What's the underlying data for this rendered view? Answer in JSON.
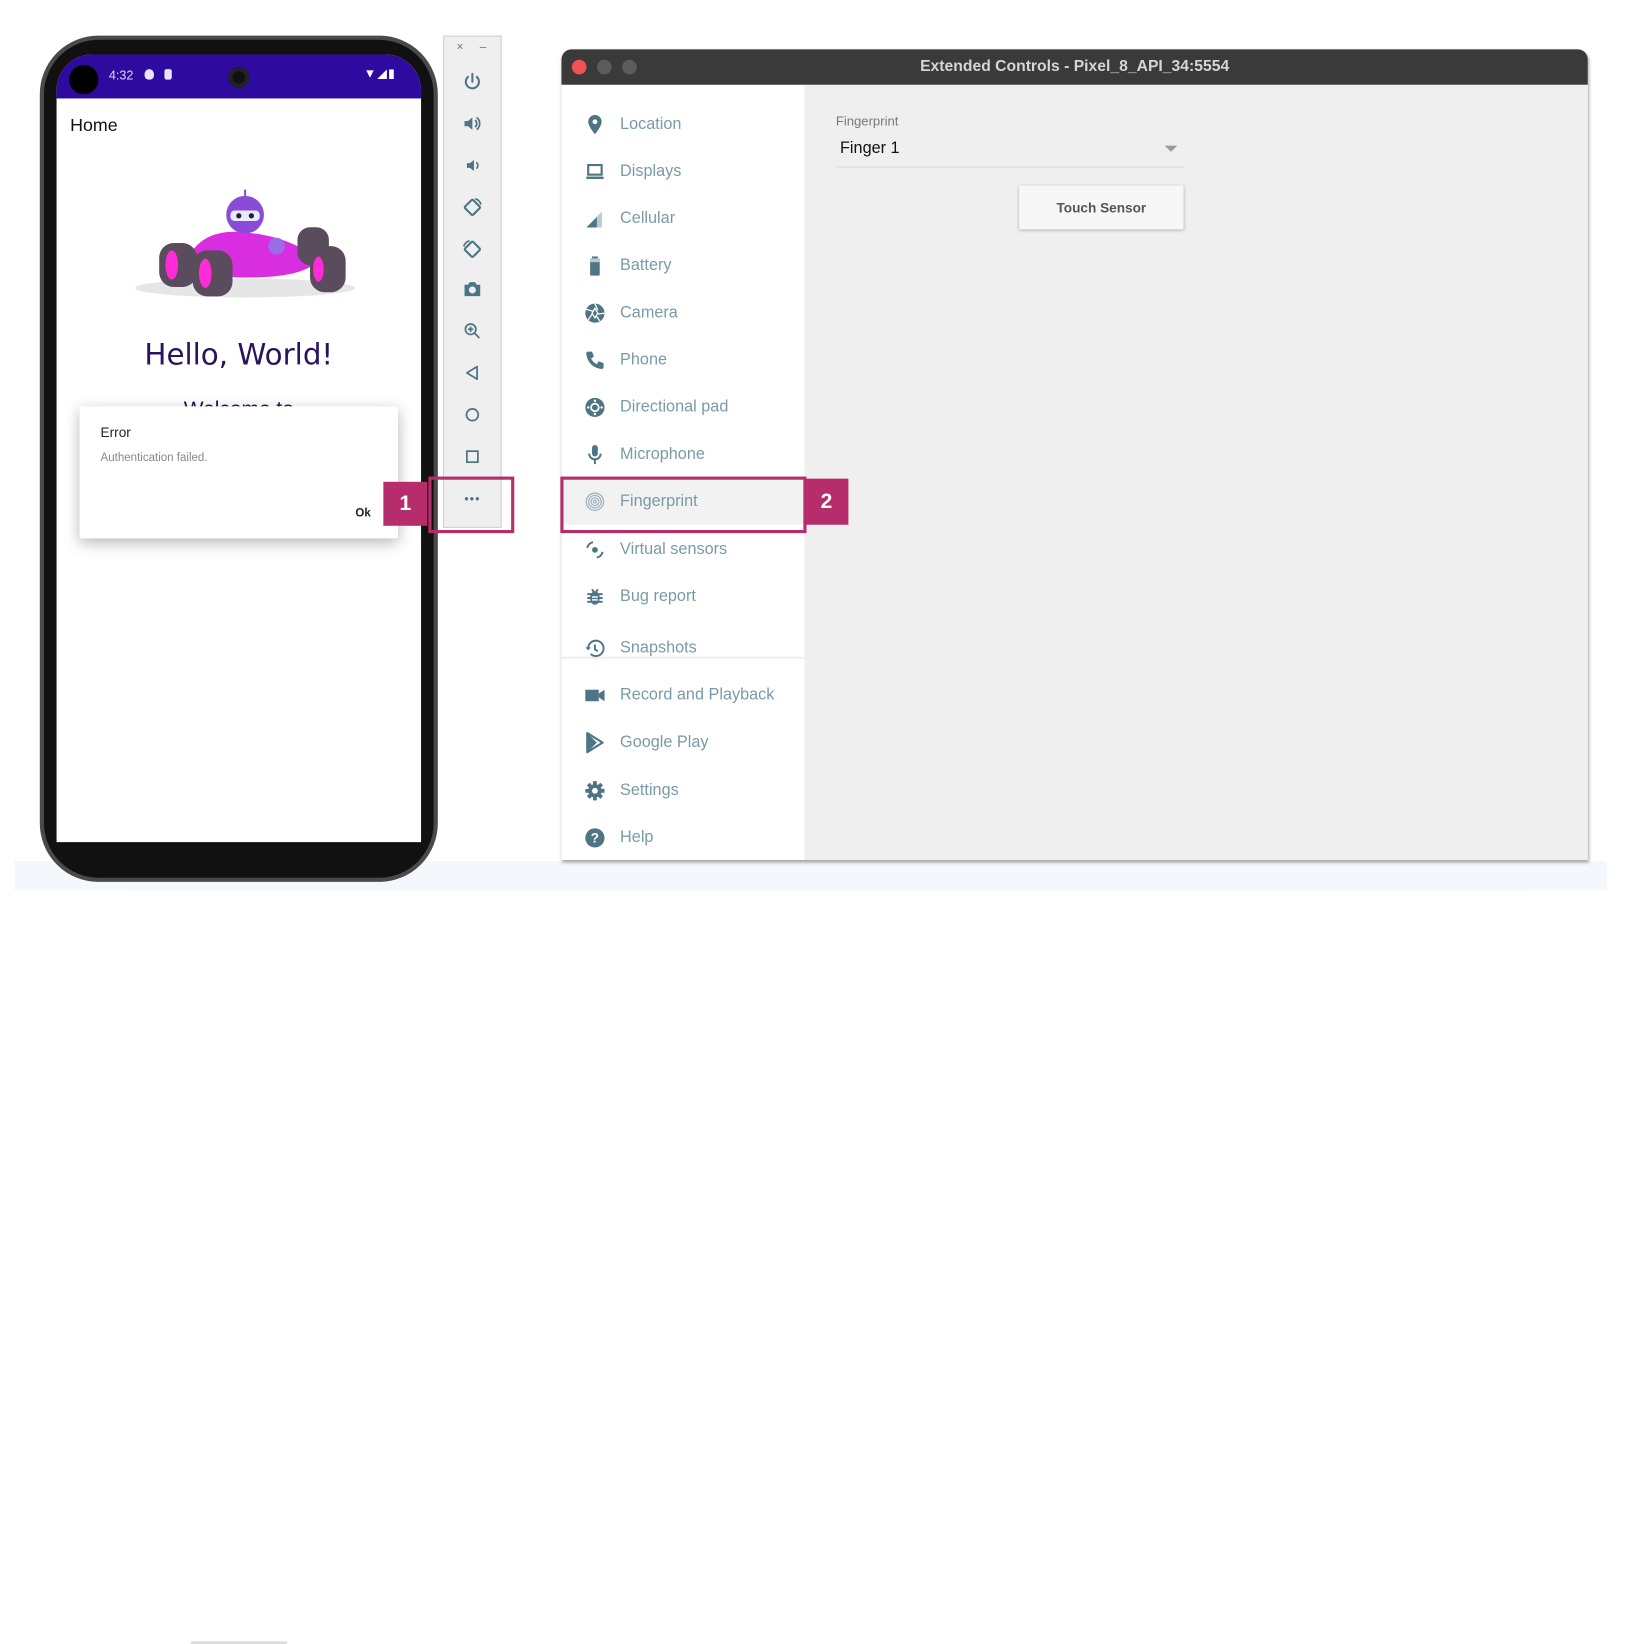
{
  "phone": {
    "status_bar": {
      "time": "4:32",
      "icons_left": [
        "shield-play-icon",
        "sim-icon"
      ],
      "icons_right": [
        "wifi-icon",
        "signal-icon",
        "battery-icon"
      ]
    },
    "app_title": "Home",
    "image": "race-car-android-mascot",
    "heading": "Hello, World!",
    "subheading": "Welcome to",
    "dialog": {
      "title": "Error",
      "message": "Authentication failed.",
      "ok_label": "Ok"
    }
  },
  "emulator_toolbar": {
    "close_label": "×",
    "minimize_label": "–",
    "buttons": [
      "power",
      "volume-up",
      "volume-down",
      "rotate-left",
      "rotate-right",
      "screenshot",
      "zoom",
      "back",
      "home",
      "overview",
      "more"
    ],
    "more_label": "•••"
  },
  "callouts": {
    "one": "1",
    "two": "2",
    "color": "#b72d6c"
  },
  "window": {
    "title": "Extended Controls - Pixel_8_API_34:5554",
    "sidebar": {
      "items": [
        {
          "label": "Location",
          "icon": "location-pin-icon"
        },
        {
          "label": "Displays",
          "icon": "laptop-icon"
        },
        {
          "label": "Cellular",
          "icon": "signal-icon"
        },
        {
          "label": "Battery",
          "icon": "battery-icon"
        },
        {
          "label": "Camera",
          "icon": "camera-aperture-icon"
        },
        {
          "label": "Phone",
          "icon": "phone-icon"
        },
        {
          "label": "Directional pad",
          "icon": "dpad-icon"
        },
        {
          "label": "Microphone",
          "icon": "microphone-icon"
        },
        {
          "label": "Fingerprint",
          "icon": "fingerprint-icon",
          "selected": true
        },
        {
          "label": "Virtual sensors",
          "icon": "virtual-sensors-icon"
        },
        {
          "label": "Bug report",
          "icon": "bug-icon"
        },
        {
          "label": "Snapshots",
          "icon": "history-icon"
        },
        {
          "label": "Record and Playback",
          "icon": "video-camera-icon"
        },
        {
          "label": "Google Play",
          "icon": "google-play-icon"
        },
        {
          "label": "Settings",
          "icon": "gear-icon"
        },
        {
          "label": "Help",
          "icon": "help-icon"
        }
      ]
    },
    "fingerprint": {
      "label": "Fingerprint",
      "selected": "Finger 1",
      "touch_button": "Touch Sensor"
    }
  },
  "colors": {
    "status_bar": "#2f0a9f",
    "icon_teal": "#4d7584",
    "nav_text": "#7a9aa8",
    "callout": "#b72d6c"
  }
}
